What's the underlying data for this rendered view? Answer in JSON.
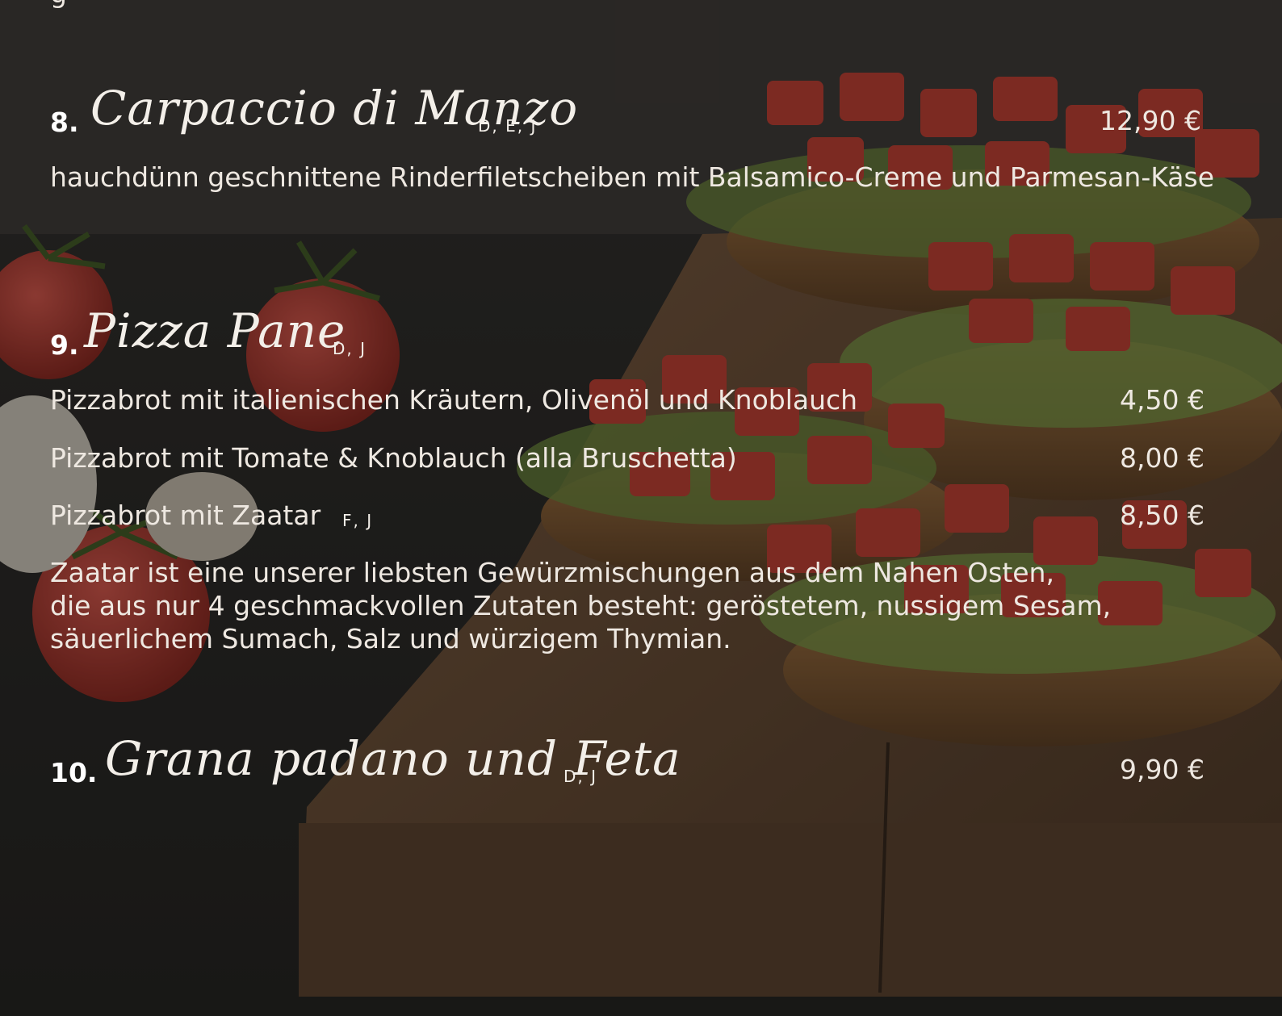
{
  "items": [
    {
      "number": "8.",
      "title": "Carpaccio di Manzo",
      "allergens": "D, E, J",
      "price": "12,90 €",
      "description": "hauchdünn geschnittene Rinderfiletscheiben mit Balsamico-Creme und Parmesan-Käse"
    },
    {
      "number": "9.",
      "title": "Pizza Pane",
      "allergens": "D, J",
      "variants": [
        {
          "label": "Pizzabrot mit italienischen Kräutern, Olivenöl und Knoblauch",
          "allergens": "",
          "price": "4,50 €"
        },
        {
          "label": "Pizzabrot mit Tomate & Knoblauch (alla Bruschetta)",
          "allergens": "",
          "price": "8,00 €"
        },
        {
          "label": "Pizzabrot mit Zaatar",
          "allergens": "F, J",
          "price": "8,50 €"
        }
      ],
      "note_lines": [
        "Zaatar ist eine unserer liebsten Gewürzmischungen aus dem Nahen Osten,",
        "die aus nur 4 geschmackvollen Zutaten besteht: geröstetem, nussigem Sesam,",
        "säuerlichem Sumach, Salz und würzigem Thymian."
      ]
    },
    {
      "number": "10.",
      "title": "Grana padano und Feta",
      "allergens": "D, J",
      "price": "9,90 €"
    }
  ],
  "colors": {
    "text": "#eee8e1",
    "overlay": "#141211",
    "tomato": "#b8322a",
    "board": "#6b4a33"
  }
}
